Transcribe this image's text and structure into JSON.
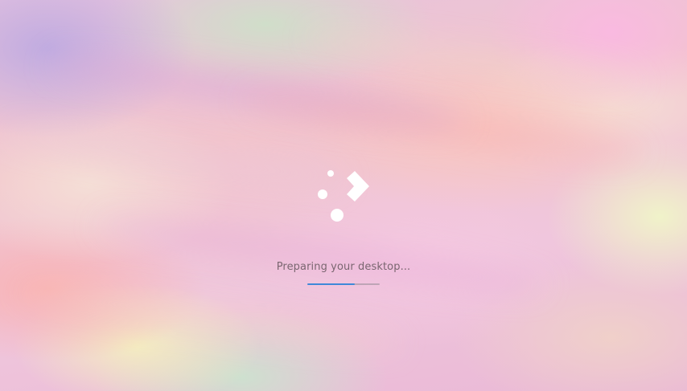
{
  "splash": {
    "status_text": "Preparing your desktop...",
    "progress": 0.66,
    "logo_icon": "launcher-arrow-dots-logo"
  },
  "colors": {
    "progress_fill": "#3f88d8",
    "progress_track": "#9a8c96",
    "status_text": "#7a6670",
    "logo": "#ffffff"
  }
}
